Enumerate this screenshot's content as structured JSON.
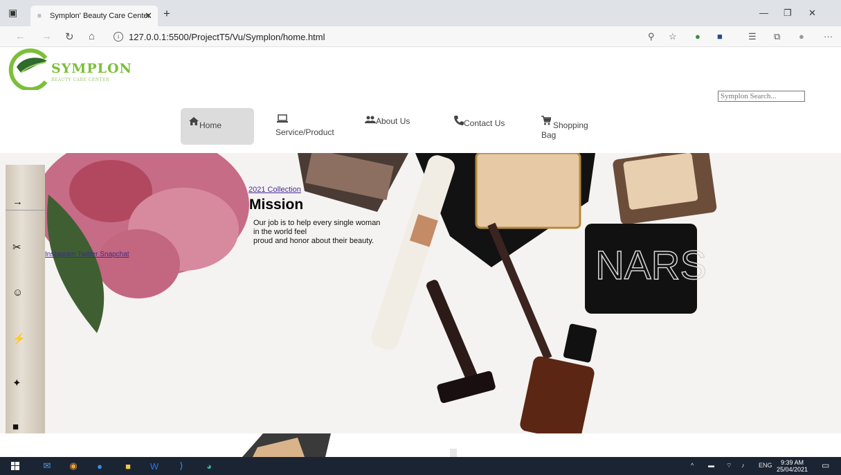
{
  "browser": {
    "tab_title": "Symplon' Beauty Care Center",
    "url": "127.0.0.1:5500/ProjectT5/Vu/Symplon/home.html"
  },
  "site": {
    "logo_name": "SYMPLON",
    "logo_tagline": "BEAUTY CARE CENTER",
    "search_placeholder": "Symplon Search...",
    "menu": [
      {
        "label": "Home",
        "icon": "home-icon"
      },
      {
        "label": "Service/Product",
        "icon": "laptop-icon"
      },
      {
        "label": "About Us",
        "icon": "people-icon"
      },
      {
        "label": "Contact Us",
        "icon": "phone-icon"
      },
      {
        "label": "Shopping Bag",
        "icon": "cart-icon"
      }
    ],
    "sidebar_link": "Instagram Twitter Snapchat",
    "hero": {
      "collection_link": "2021 Collection",
      "title": "Mission",
      "desc_line1": "Our job is to help every single woman",
      "desc_line2": "in the world feel",
      "desc_line3": "proud and honor about their beauty."
    }
  },
  "taskbar": {
    "lang": "ENG",
    "time": "9:39 AM",
    "date": "25/04/2021"
  },
  "colors": {
    "brand_green": "#7cbf3a",
    "menu_active_bg": "#dcdcdc",
    "taskbar_bg": "#1b2433"
  }
}
